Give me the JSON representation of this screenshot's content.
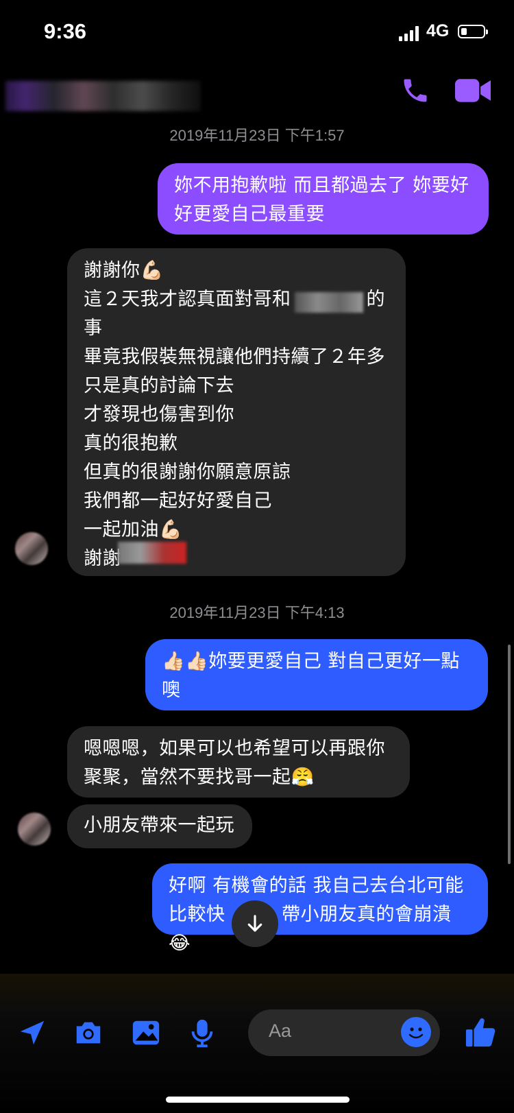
{
  "status_bar": {
    "time": "9:36",
    "network": "4G"
  },
  "header": {
    "contact_name_redacted": true
  },
  "timestamps": [
    "2019年11月23日 下午1:57",
    "2019年11月23日 下午4:13"
  ],
  "messages": [
    {
      "direction": "out",
      "color": "#8b4dff",
      "text": "妳不用抱歉啦 而且都過去了 妳要好\n好更愛自己最重要"
    },
    {
      "direction": "in",
      "text": "謝謝你💪🏻\n這２天我才認真面對哥和　　　　的\n事\n畢竟我假裝無視讓他們持續了２年多\n只是真的討論下去\n才發現也傷害到你\n真的很抱歉\n但真的很謝謝你願意原諒\n我們都一起好好愛自己\n一起加油💪🏻\n謝謝"
    },
    {
      "direction": "out",
      "color": "#2f5cff",
      "text": "👍🏻👍🏻妳要更愛自己 對自己更好一點\n噢"
    },
    {
      "direction": "in",
      "text": "嗯嗯嗯，如果可以也希望可以再跟你\n聚聚，當然不要找哥一起😤"
    },
    {
      "direction": "in",
      "text": "小朋友帶來一起玩"
    },
    {
      "direction": "out",
      "color": "#2f5cff",
      "text": "好啊 有機會的話 我自己去台北可能\n比較快　　　帶小朋友真的會崩潰😂"
    }
  ],
  "composer": {
    "placeholder": "Aa"
  },
  "colors": {
    "outgoing_purple": "#8b4dff",
    "outgoing_blue": "#2f5cff",
    "incoming": "#262626",
    "accent": "#9b5cff",
    "toolbar_blue": "#2f6bff"
  },
  "icons": [
    "phone-icon",
    "video-icon",
    "location-arrow-icon",
    "camera-icon",
    "image-icon",
    "microphone-icon",
    "emoji-icon",
    "thumbs-up-icon",
    "arrow-down-icon"
  ]
}
